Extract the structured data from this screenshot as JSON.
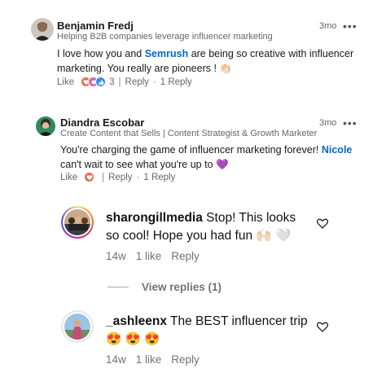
{
  "comments": [
    {
      "name": "Benjamin Fredj",
      "headline": "Helping B2B companies leverage influencer marketing",
      "time": "3mo",
      "more": "•••",
      "text_1": "I love how you and ",
      "mention": "Semrush",
      "text_2": " are being so creative with influencer marketing. You really are pioneers ! ",
      "emoji": "👏🏻",
      "like_label": "Like",
      "reaction_count": "3",
      "reply_label": "Reply",
      "replies_label": "1 Reply"
    },
    {
      "name": "Diandra Escobar",
      "headline": "Create Content that Sells | Content Strategist & Growth Marketer",
      "time": "3mo",
      "more": "•••",
      "text_1": "You're charging the game of influencer marketing forever! ",
      "mention": "Nicole",
      "text_2": " can't wait to see what you're up to ",
      "emoji": "💜",
      "like_label": "Like",
      "reply_label": "Reply",
      "replies_label": "1 Reply"
    }
  ],
  "ig_comments": [
    {
      "username": "sharongillmedia",
      "text": " Stop! This looks so cool! Hope you had fun ",
      "emoji": "🙌🏻 🤍",
      "time": "14w",
      "likes": "1 like",
      "reply_label": "Reply",
      "view_replies": "View replies (1)"
    },
    {
      "username": "_ashleenx",
      "text": " The BEST influencer trip",
      "emoji": "😍 😍 😍",
      "time": "14w",
      "likes": "1 like",
      "reply_label": "Reply"
    }
  ],
  "colors": {
    "link_blue": "#0a66c2",
    "muted": "#666666",
    "ig_muted": "#737373"
  },
  "icons": [
    "like-reaction-icon",
    "love-reaction-icon",
    "support-reaction-icon",
    "heart-outline-icon",
    "more-options-icon"
  ]
}
